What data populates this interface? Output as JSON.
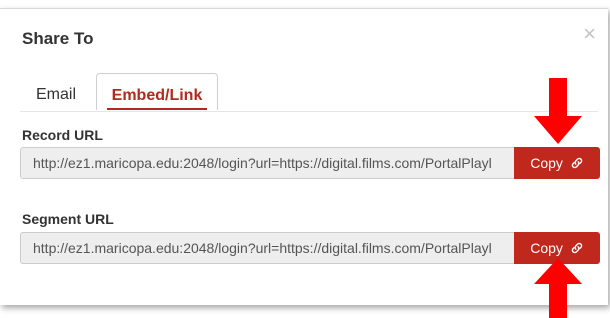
{
  "dialog": {
    "title": "Share To",
    "close_glyph": "×"
  },
  "tabs": [
    {
      "label": "Email",
      "active": false
    },
    {
      "label": "Embed/Link",
      "active": true
    }
  ],
  "record": {
    "label": "Record URL",
    "url": "http://ez1.maricopa.edu:2048/login?url=https://digital.films.com/PortalPlayl",
    "copy_label": "Copy"
  },
  "segment": {
    "label": "Segment URL",
    "url": "http://ez1.maricopa.edu:2048/login?url=https://digital.films.com/PortalPlayl",
    "copy_label": "Copy"
  },
  "colors": {
    "accent": "#b22a1f",
    "button": "#c0281d",
    "annotation_arrow": "#ff0000"
  },
  "icons": {
    "copy": "link-icon",
    "close": "close-icon",
    "annotation": "red-arrow-icon"
  }
}
